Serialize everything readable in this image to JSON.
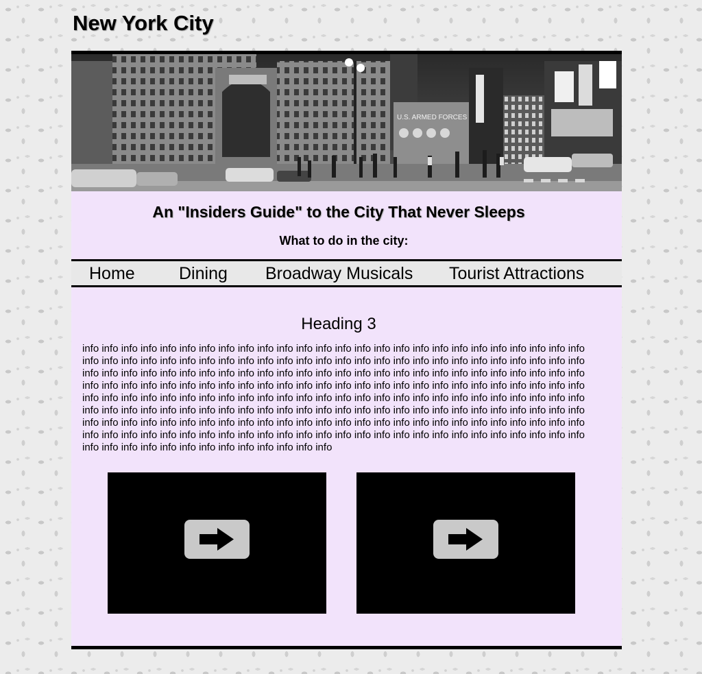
{
  "header": {
    "title": "New York City"
  },
  "hero": {
    "subtitle": "An \"Insiders Guide\" to the City That Never Sleeps",
    "tagline": "What to do in the city:"
  },
  "nav": {
    "items": [
      "Home",
      "Dining",
      "Broadway Musicals",
      "Tourist Attractions"
    ]
  },
  "content": {
    "heading": "Heading 3",
    "body": "info info info info info info info info info info info info info info info info info info info info info info info info info info info info info info info info info info info info info info info info info info info info info info info info info info info info info info info info info info info info info info info info info info info info info info info info info info info info info info info info info info info info info info info info info info info info info info info info info info info info info info info info info info info info info info info info info info info info info info info info info info info info info info info info info info info info info info info info info info info info info info info info info info info info info info info info info info info info info info info info info info info info info info info info info info info info info info info info info info info info info info info info info info info info info info info info info info info info info info info info info info info info info info info info info info info info info info info info info info info info info"
  },
  "videos": [
    {
      "icon": "play-arrow-icon"
    },
    {
      "icon": "play-arrow-icon"
    }
  ],
  "colors": {
    "panel": "#f2e3fb",
    "nav": "#e8e8e8",
    "border": "#000000"
  }
}
